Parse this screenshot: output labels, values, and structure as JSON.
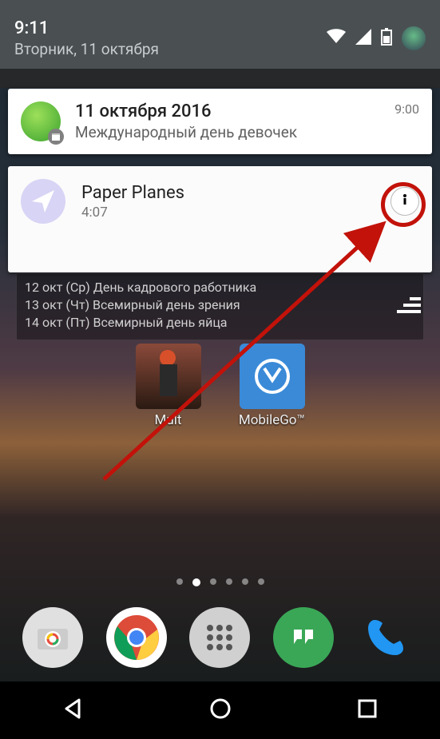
{
  "status": {
    "time": "9:11",
    "date": "Вторник, 11 октября"
  },
  "notifications": [
    {
      "title": "11 октября 2016",
      "sub": "Международный день девочек",
      "time": "9:00",
      "icon": "globe-icon"
    },
    {
      "title": "Paper Planes",
      "sub": "4:07",
      "icon": "paper-plane-icon",
      "action_icon": "info-icon"
    }
  ],
  "calendar_widget": {
    "rows": [
      "12 окт (Ср) День кадрового работника",
      "13 окт (Чт) Всемирный день зрения",
      "14 окт (Пт) Всемирный день яйца"
    ]
  },
  "apps": [
    {
      "label": "Mult",
      "icon": "mult-icon"
    },
    {
      "label": "MobileGo™",
      "icon": "mobilego-icon"
    }
  ],
  "dock": [
    {
      "name": "camera"
    },
    {
      "name": "chrome"
    },
    {
      "name": "app-drawer"
    },
    {
      "name": "hangouts"
    },
    {
      "name": "phone"
    }
  ],
  "pager": {
    "count": 6,
    "active": 1
  },
  "annotation": {
    "arrow_color": "#c2120a"
  }
}
